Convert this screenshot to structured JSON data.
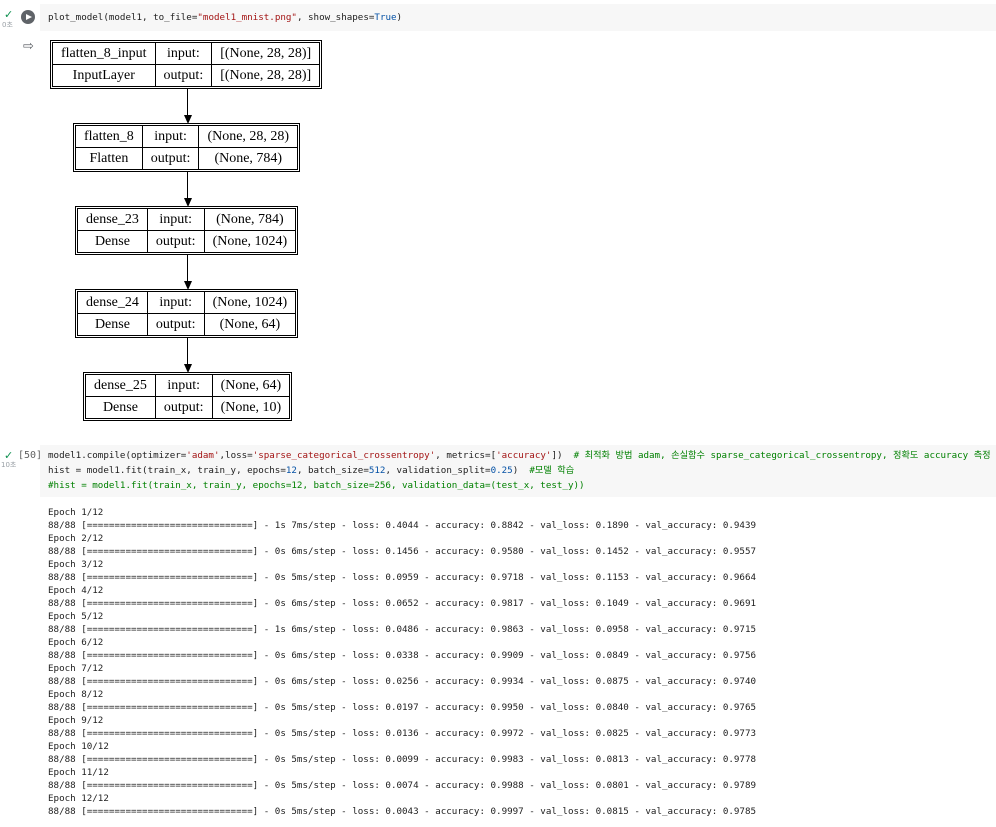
{
  "cell1": {
    "status_check": "✓",
    "exec_time": "0초",
    "code": {
      "fn": "plot_model",
      "pre": "(model1, to_file=",
      "str": "\"model1_mnist.png\"",
      "mid": ", show_shapes=",
      "kw": "True",
      "post": ")"
    },
    "output_icon": "output-icon",
    "graph": {
      "nodes": [
        {
          "name": "flatten_8_input",
          "type": "InputLayer",
          "input_label": "input:",
          "output_label": "output:",
          "input": "[(None, 28, 28)]",
          "output": "[(None, 28, 28)]"
        },
        {
          "name": "flatten_8",
          "type": "Flatten",
          "input_label": "input:",
          "output_label": "output:",
          "input": "(None, 28, 28)",
          "output": "(None, 784)"
        },
        {
          "name": "dense_23",
          "type": "Dense",
          "input_label": "input:",
          "output_label": "output:",
          "input": "(None, 784)",
          "output": "(None, 1024)"
        },
        {
          "name": "dense_24",
          "type": "Dense",
          "input_label": "input:",
          "output_label": "output:",
          "input": "(None, 1024)",
          "output": "(None, 64)"
        },
        {
          "name": "dense_25",
          "type": "Dense",
          "input_label": "input:",
          "output_label": "output:",
          "input": "(None, 64)",
          "output": "(None, 10)"
        }
      ]
    }
  },
  "cell2": {
    "status_check": "✓",
    "exec_time": "10초",
    "prompt": "[50]",
    "code_lines": [
      [
        {
          "t": "model1.compile(optimizer=",
          "c": "fn"
        },
        {
          "t": "'adam'",
          "c": "str"
        },
        {
          "t": ",loss=",
          "c": "fn"
        },
        {
          "t": "'sparse_categorical_crossentropy'",
          "c": "str"
        },
        {
          "t": ", metrics=[",
          "c": "fn"
        },
        {
          "t": "'accuracy'",
          "c": "str"
        },
        {
          "t": "])  ",
          "c": "fn"
        },
        {
          "t": "# 최적화 방법 adam, 손실함수 sparse_categorical_crossentropy, 정확도 accuracy 측정",
          "c": "cmt"
        }
      ],
      [
        {
          "t": "hist = model1.fit(train_x, train_y, epochs=",
          "c": "fn"
        },
        {
          "t": "12",
          "c": "kw"
        },
        {
          "t": ", batch_size=",
          "c": "fn"
        },
        {
          "t": "512",
          "c": "kw"
        },
        {
          "t": ", validation_split=",
          "c": "fn"
        },
        {
          "t": "0.25",
          "c": "kw"
        },
        {
          "t": ")  ",
          "c": "fn"
        },
        {
          "t": "#모델 학습",
          "c": "cmt"
        }
      ],
      [
        {
          "t": "#hist = model1.fit(train_x, train_y, epochs=12, batch_size=256, validation_data=(test_x, test_y))",
          "c": "cmt"
        }
      ]
    ],
    "output_lines": [
      "Epoch 1/12",
      "88/88 [==============================] - 1s 7ms/step - loss: 0.4044 - accuracy: 0.8842 - val_loss: 0.1890 - val_accuracy: 0.9439",
      "Epoch 2/12",
      "88/88 [==============================] - 0s 6ms/step - loss: 0.1456 - accuracy: 0.9580 - val_loss: 0.1452 - val_accuracy: 0.9557",
      "Epoch 3/12",
      "88/88 [==============================] - 0s 5ms/step - loss: 0.0959 - accuracy: 0.9718 - val_loss: 0.1153 - val_accuracy: 0.9664",
      "Epoch 4/12",
      "88/88 [==============================] - 0s 6ms/step - loss: 0.0652 - accuracy: 0.9817 - val_loss: 0.1049 - val_accuracy: 0.9691",
      "Epoch 5/12",
      "88/88 [==============================] - 1s 6ms/step - loss: 0.0486 - accuracy: 0.9863 - val_loss: 0.0958 - val_accuracy: 0.9715",
      "Epoch 6/12",
      "88/88 [==============================] - 0s 6ms/step - loss: 0.0338 - accuracy: 0.9909 - val_loss: 0.0849 - val_accuracy: 0.9756",
      "Epoch 7/12",
      "88/88 [==============================] - 0s 6ms/step - loss: 0.0256 - accuracy: 0.9934 - val_loss: 0.0875 - val_accuracy: 0.9740",
      "Epoch 8/12",
      "88/88 [==============================] - 0s 5ms/step - loss: 0.0197 - accuracy: 0.9950 - val_loss: 0.0840 - val_accuracy: 0.9765",
      "Epoch 9/12",
      "88/88 [==============================] - 0s 5ms/step - loss: 0.0136 - accuracy: 0.9972 - val_loss: 0.0825 - val_accuracy: 0.9773",
      "Epoch 10/12",
      "88/88 [==============================] - 0s 5ms/step - loss: 0.0099 - accuracy: 0.9983 - val_loss: 0.0813 - val_accuracy: 0.9778",
      "Epoch 11/12",
      "88/88 [==============================] - 0s 5ms/step - loss: 0.0074 - accuracy: 0.9988 - val_loss: 0.0801 - val_accuracy: 0.9789",
      "Epoch 12/12",
      "88/88 [==============================] - 0s 5ms/step - loss: 0.0043 - accuracy: 0.9997 - val_loss: 0.0815 - val_accuracy: 0.9785"
    ]
  }
}
